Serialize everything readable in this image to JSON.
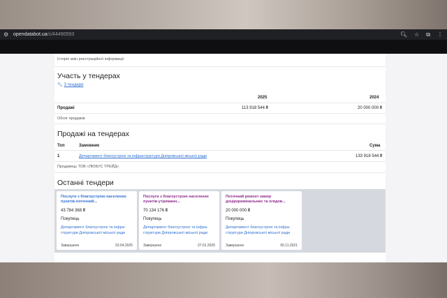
{
  "browser": {
    "url_host": "opendatabot.ua",
    "url_path": "/c/44490593"
  },
  "history_link": "Історія змін реєстраційної інформації",
  "tenders_section": {
    "title": "Участь у тендерах",
    "link": "3 тендери",
    "year_2025": "2025",
    "year_2024": "2024",
    "row_label": "Продажі",
    "value_2025": "113 918 544 ₴",
    "value_2024": "20 000 000 ₴",
    "volume_label": "Обсяг продажів"
  },
  "sales_section": {
    "title": "Продажі на тендерах",
    "col_top": "Топ",
    "col_customer": "Замовник",
    "col_sum": "Сума",
    "rows": [
      {
        "rank": "1",
        "customer": "Департамент благоустрою та інфраструктури Дніпровської міської ради",
        "sum": "133 918 544 ₴"
      }
    ],
    "seller_label": "Продавець ТОВ «ЛЮБУС ТРЕЙД»"
  },
  "recent_section": {
    "title": "Останні тендери",
    "cards": [
      {
        "title": "Послуги з благоустрою населених пунктів-поточний...",
        "amount": "43 784 368 ₴",
        "role": "Покупець",
        "dept": "Департамент благоустрою та інфра-структури Дніпровської міської ради",
        "status": "Завершено",
        "date": "23.04.2025",
        "title_color": "#2f6fd0"
      },
      {
        "title": "Послуги з благоустрою населених пунктів-утриманн...",
        "amount": "70 134 176 ₴",
        "role": "Покупець",
        "dept": "Департамент благоустрою та інфра-структури Дніпровської міської ради",
        "status": "Завершено",
        "date": "27.01.2025",
        "title_color": "#8e2a8c"
      },
      {
        "title": "Поточний ремонт камер доціркримінальних та огядов...",
        "amount": "20 000 000 ₴",
        "role": "Покупець",
        "dept": "Департамент благоустрою та інфра-структури Дніпровської міської ради",
        "status": "Завершено",
        "date": "05.11.2021",
        "title_color": "#8e2a8c"
      }
    ]
  }
}
